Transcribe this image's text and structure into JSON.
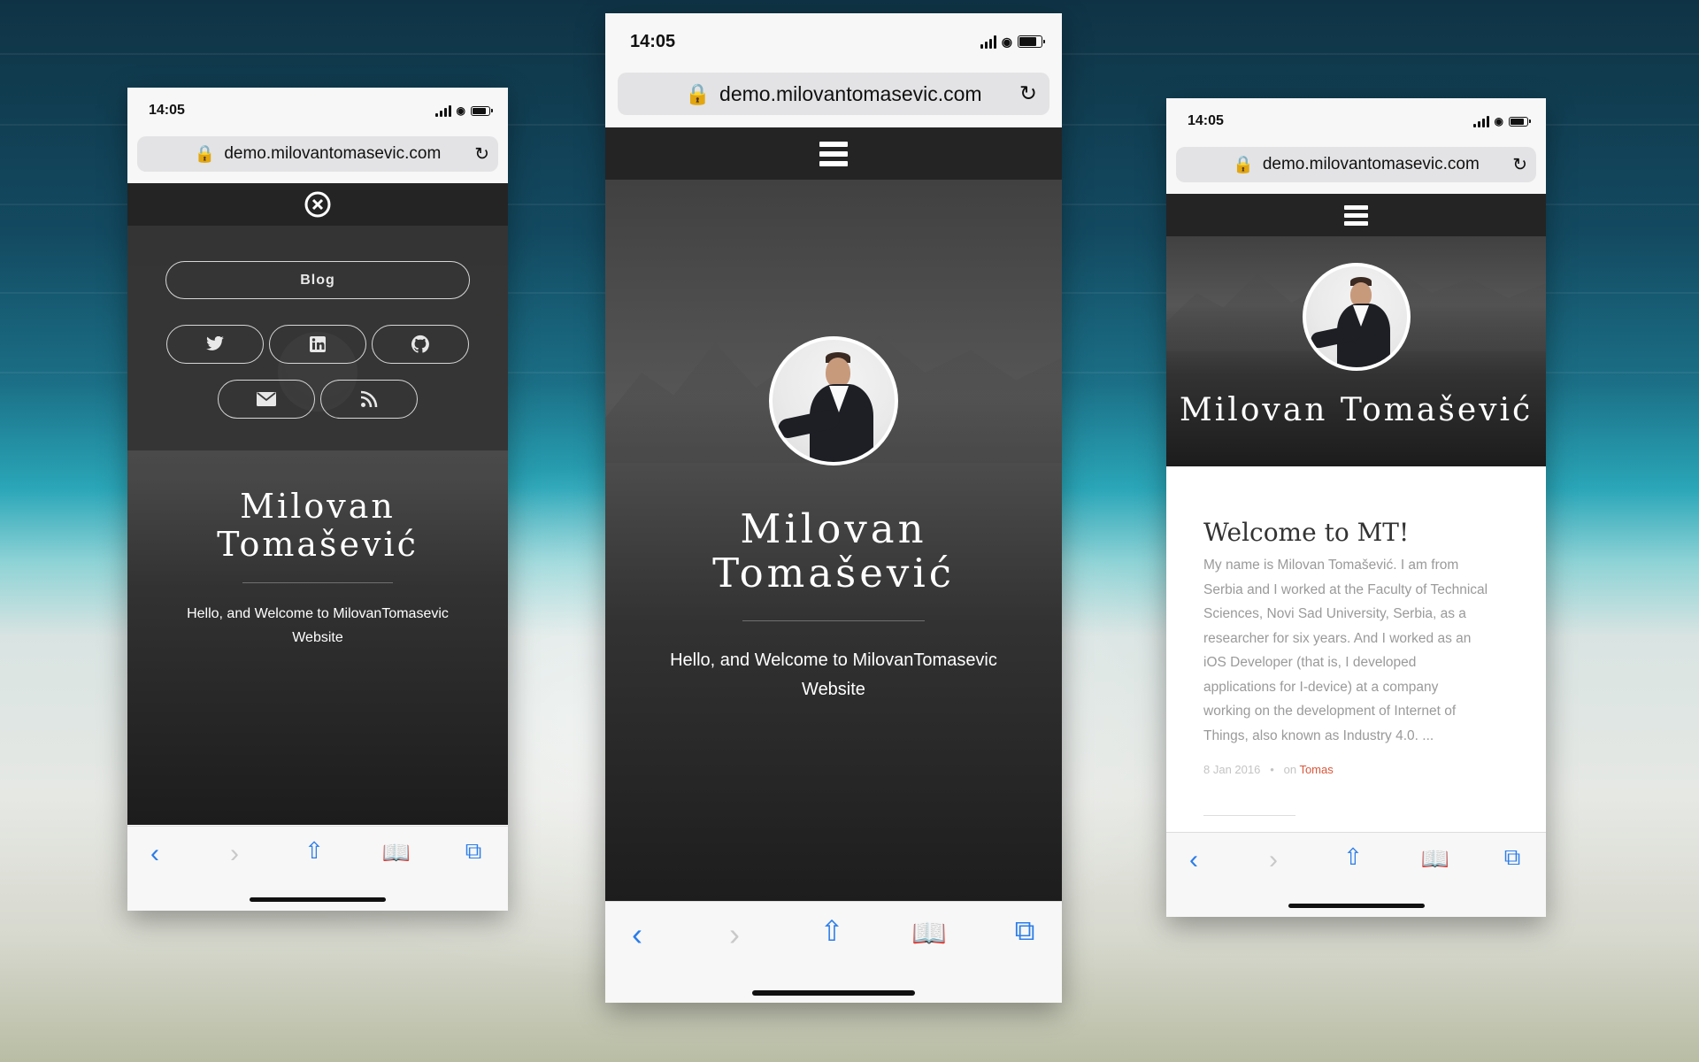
{
  "status": {
    "time": "14:05"
  },
  "browser": {
    "url": "demo.milovantomasevic.com"
  },
  "site": {
    "name_line1": "Milovan",
    "name_line2": "Tomašević",
    "name_full": "Milovan Tomašević",
    "tagline_line1": "Hello, and Welcome to MilovanTomasevic",
    "tagline_line2": "Website"
  },
  "menu": {
    "blog_label": "Blog",
    "social": [
      "twitter-icon",
      "linkedin-icon",
      "github-icon",
      "mail-icon",
      "rss-icon"
    ]
  },
  "post": {
    "title": "Welcome to MT!",
    "body_lines": [
      "My name is Milovan Tomašević. I am from",
      "Serbia and I worked at the Faculty of Technical",
      "Sciences, Novi Sad University, Serbia, as a",
      "researcher for six years. And I worked as an",
      "iOS Developer (that is, I developed",
      "applications for I-device) at a company",
      "working on the development of Internet of",
      "Things, also known as Industry 4.0. ..."
    ],
    "date": "8 Jan 2016",
    "bullet": "•",
    "on": "on",
    "author": "Tomas"
  },
  "colors": {
    "accent_link": "#d9573b",
    "ios_blue": "#2b7de9",
    "header_dark": "#242424"
  }
}
